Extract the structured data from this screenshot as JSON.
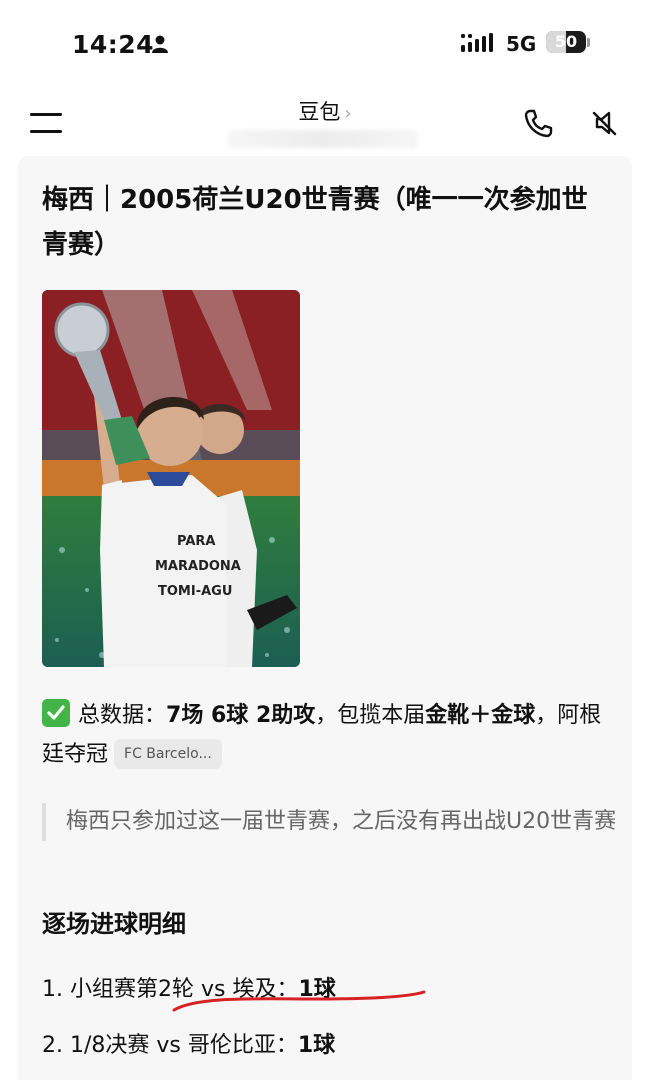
{
  "status_bar": {
    "time": "14:24",
    "network": "5G",
    "battery": "50",
    "battery_level": 0.5,
    "icons": [
      "person-icon",
      "signal-icon",
      "battery-icon"
    ]
  },
  "app": {
    "title": "豆包",
    "chevron": "›",
    "icons": [
      "menu-icon",
      "phone-icon",
      "mute-icon",
      "chevron-right-icon"
    ]
  },
  "article": {
    "title": "梅西｜2005荷兰U20世青赛（唯一一次参加世青赛）",
    "photo_shirt_text": [
      "PARA",
      "MARADONA",
      "TOMI-AGU"
    ],
    "summary": {
      "lead": "总数据：",
      "stats": "7场 6球 2助攻",
      "mid": "，包揽本届",
      "award": "金靴＋金球",
      "tail": "，阿根廷夺冠",
      "source": "FC Barcelo..."
    },
    "quote": "梅西只参加过这一届世青赛，之后没有再出战U20世青赛",
    "section_heading": "逐场进球明细",
    "goals": [
      {
        "index": "1.",
        "match": "小组赛第2轮 vs 埃及：",
        "goals": "1球"
      },
      {
        "index": "2.",
        "match": "1/8决赛 vs 哥伦比亚：",
        "goals": "1球"
      }
    ]
  },
  "colors": {
    "check": "#43b548",
    "underline": "#d62222",
    "card_bg": "#f7f7f8"
  }
}
